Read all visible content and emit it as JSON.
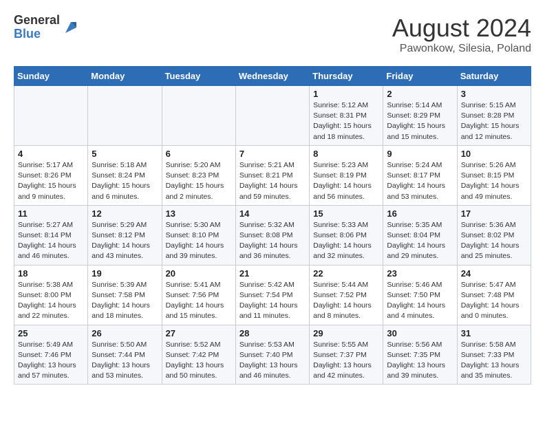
{
  "header": {
    "logo_general": "General",
    "logo_blue": "Blue",
    "month_title": "August 2024",
    "location": "Pawonkow, Silesia, Poland"
  },
  "days_of_week": [
    "Sunday",
    "Monday",
    "Tuesday",
    "Wednesday",
    "Thursday",
    "Friday",
    "Saturday"
  ],
  "weeks": [
    [
      {
        "day": "",
        "info": ""
      },
      {
        "day": "",
        "info": ""
      },
      {
        "day": "",
        "info": ""
      },
      {
        "day": "",
        "info": ""
      },
      {
        "day": "1",
        "info": "Sunrise: 5:12 AM\nSunset: 8:31 PM\nDaylight: 15 hours\nand 18 minutes."
      },
      {
        "day": "2",
        "info": "Sunrise: 5:14 AM\nSunset: 8:29 PM\nDaylight: 15 hours\nand 15 minutes."
      },
      {
        "day": "3",
        "info": "Sunrise: 5:15 AM\nSunset: 8:28 PM\nDaylight: 15 hours\nand 12 minutes."
      }
    ],
    [
      {
        "day": "4",
        "info": "Sunrise: 5:17 AM\nSunset: 8:26 PM\nDaylight: 15 hours\nand 9 minutes."
      },
      {
        "day": "5",
        "info": "Sunrise: 5:18 AM\nSunset: 8:24 PM\nDaylight: 15 hours\nand 6 minutes."
      },
      {
        "day": "6",
        "info": "Sunrise: 5:20 AM\nSunset: 8:23 PM\nDaylight: 15 hours\nand 2 minutes."
      },
      {
        "day": "7",
        "info": "Sunrise: 5:21 AM\nSunset: 8:21 PM\nDaylight: 14 hours\nand 59 minutes."
      },
      {
        "day": "8",
        "info": "Sunrise: 5:23 AM\nSunset: 8:19 PM\nDaylight: 14 hours\nand 56 minutes."
      },
      {
        "day": "9",
        "info": "Sunrise: 5:24 AM\nSunset: 8:17 PM\nDaylight: 14 hours\nand 53 minutes."
      },
      {
        "day": "10",
        "info": "Sunrise: 5:26 AM\nSunset: 8:15 PM\nDaylight: 14 hours\nand 49 minutes."
      }
    ],
    [
      {
        "day": "11",
        "info": "Sunrise: 5:27 AM\nSunset: 8:14 PM\nDaylight: 14 hours\nand 46 minutes."
      },
      {
        "day": "12",
        "info": "Sunrise: 5:29 AM\nSunset: 8:12 PM\nDaylight: 14 hours\nand 43 minutes."
      },
      {
        "day": "13",
        "info": "Sunrise: 5:30 AM\nSunset: 8:10 PM\nDaylight: 14 hours\nand 39 minutes."
      },
      {
        "day": "14",
        "info": "Sunrise: 5:32 AM\nSunset: 8:08 PM\nDaylight: 14 hours\nand 36 minutes."
      },
      {
        "day": "15",
        "info": "Sunrise: 5:33 AM\nSunset: 8:06 PM\nDaylight: 14 hours\nand 32 minutes."
      },
      {
        "day": "16",
        "info": "Sunrise: 5:35 AM\nSunset: 8:04 PM\nDaylight: 14 hours\nand 29 minutes."
      },
      {
        "day": "17",
        "info": "Sunrise: 5:36 AM\nSunset: 8:02 PM\nDaylight: 14 hours\nand 25 minutes."
      }
    ],
    [
      {
        "day": "18",
        "info": "Sunrise: 5:38 AM\nSunset: 8:00 PM\nDaylight: 14 hours\nand 22 minutes."
      },
      {
        "day": "19",
        "info": "Sunrise: 5:39 AM\nSunset: 7:58 PM\nDaylight: 14 hours\nand 18 minutes."
      },
      {
        "day": "20",
        "info": "Sunrise: 5:41 AM\nSunset: 7:56 PM\nDaylight: 14 hours\nand 15 minutes."
      },
      {
        "day": "21",
        "info": "Sunrise: 5:42 AM\nSunset: 7:54 PM\nDaylight: 14 hours\nand 11 minutes."
      },
      {
        "day": "22",
        "info": "Sunrise: 5:44 AM\nSunset: 7:52 PM\nDaylight: 14 hours\nand 8 minutes."
      },
      {
        "day": "23",
        "info": "Sunrise: 5:46 AM\nSunset: 7:50 PM\nDaylight: 14 hours\nand 4 minutes."
      },
      {
        "day": "24",
        "info": "Sunrise: 5:47 AM\nSunset: 7:48 PM\nDaylight: 14 hours\nand 0 minutes."
      }
    ],
    [
      {
        "day": "25",
        "info": "Sunrise: 5:49 AM\nSunset: 7:46 PM\nDaylight: 13 hours\nand 57 minutes."
      },
      {
        "day": "26",
        "info": "Sunrise: 5:50 AM\nSunset: 7:44 PM\nDaylight: 13 hours\nand 53 minutes."
      },
      {
        "day": "27",
        "info": "Sunrise: 5:52 AM\nSunset: 7:42 PM\nDaylight: 13 hours\nand 50 minutes."
      },
      {
        "day": "28",
        "info": "Sunrise: 5:53 AM\nSunset: 7:40 PM\nDaylight: 13 hours\nand 46 minutes."
      },
      {
        "day": "29",
        "info": "Sunrise: 5:55 AM\nSunset: 7:37 PM\nDaylight: 13 hours\nand 42 minutes."
      },
      {
        "day": "30",
        "info": "Sunrise: 5:56 AM\nSunset: 7:35 PM\nDaylight: 13 hours\nand 39 minutes."
      },
      {
        "day": "31",
        "info": "Sunrise: 5:58 AM\nSunset: 7:33 PM\nDaylight: 13 hours\nand 35 minutes."
      }
    ]
  ]
}
